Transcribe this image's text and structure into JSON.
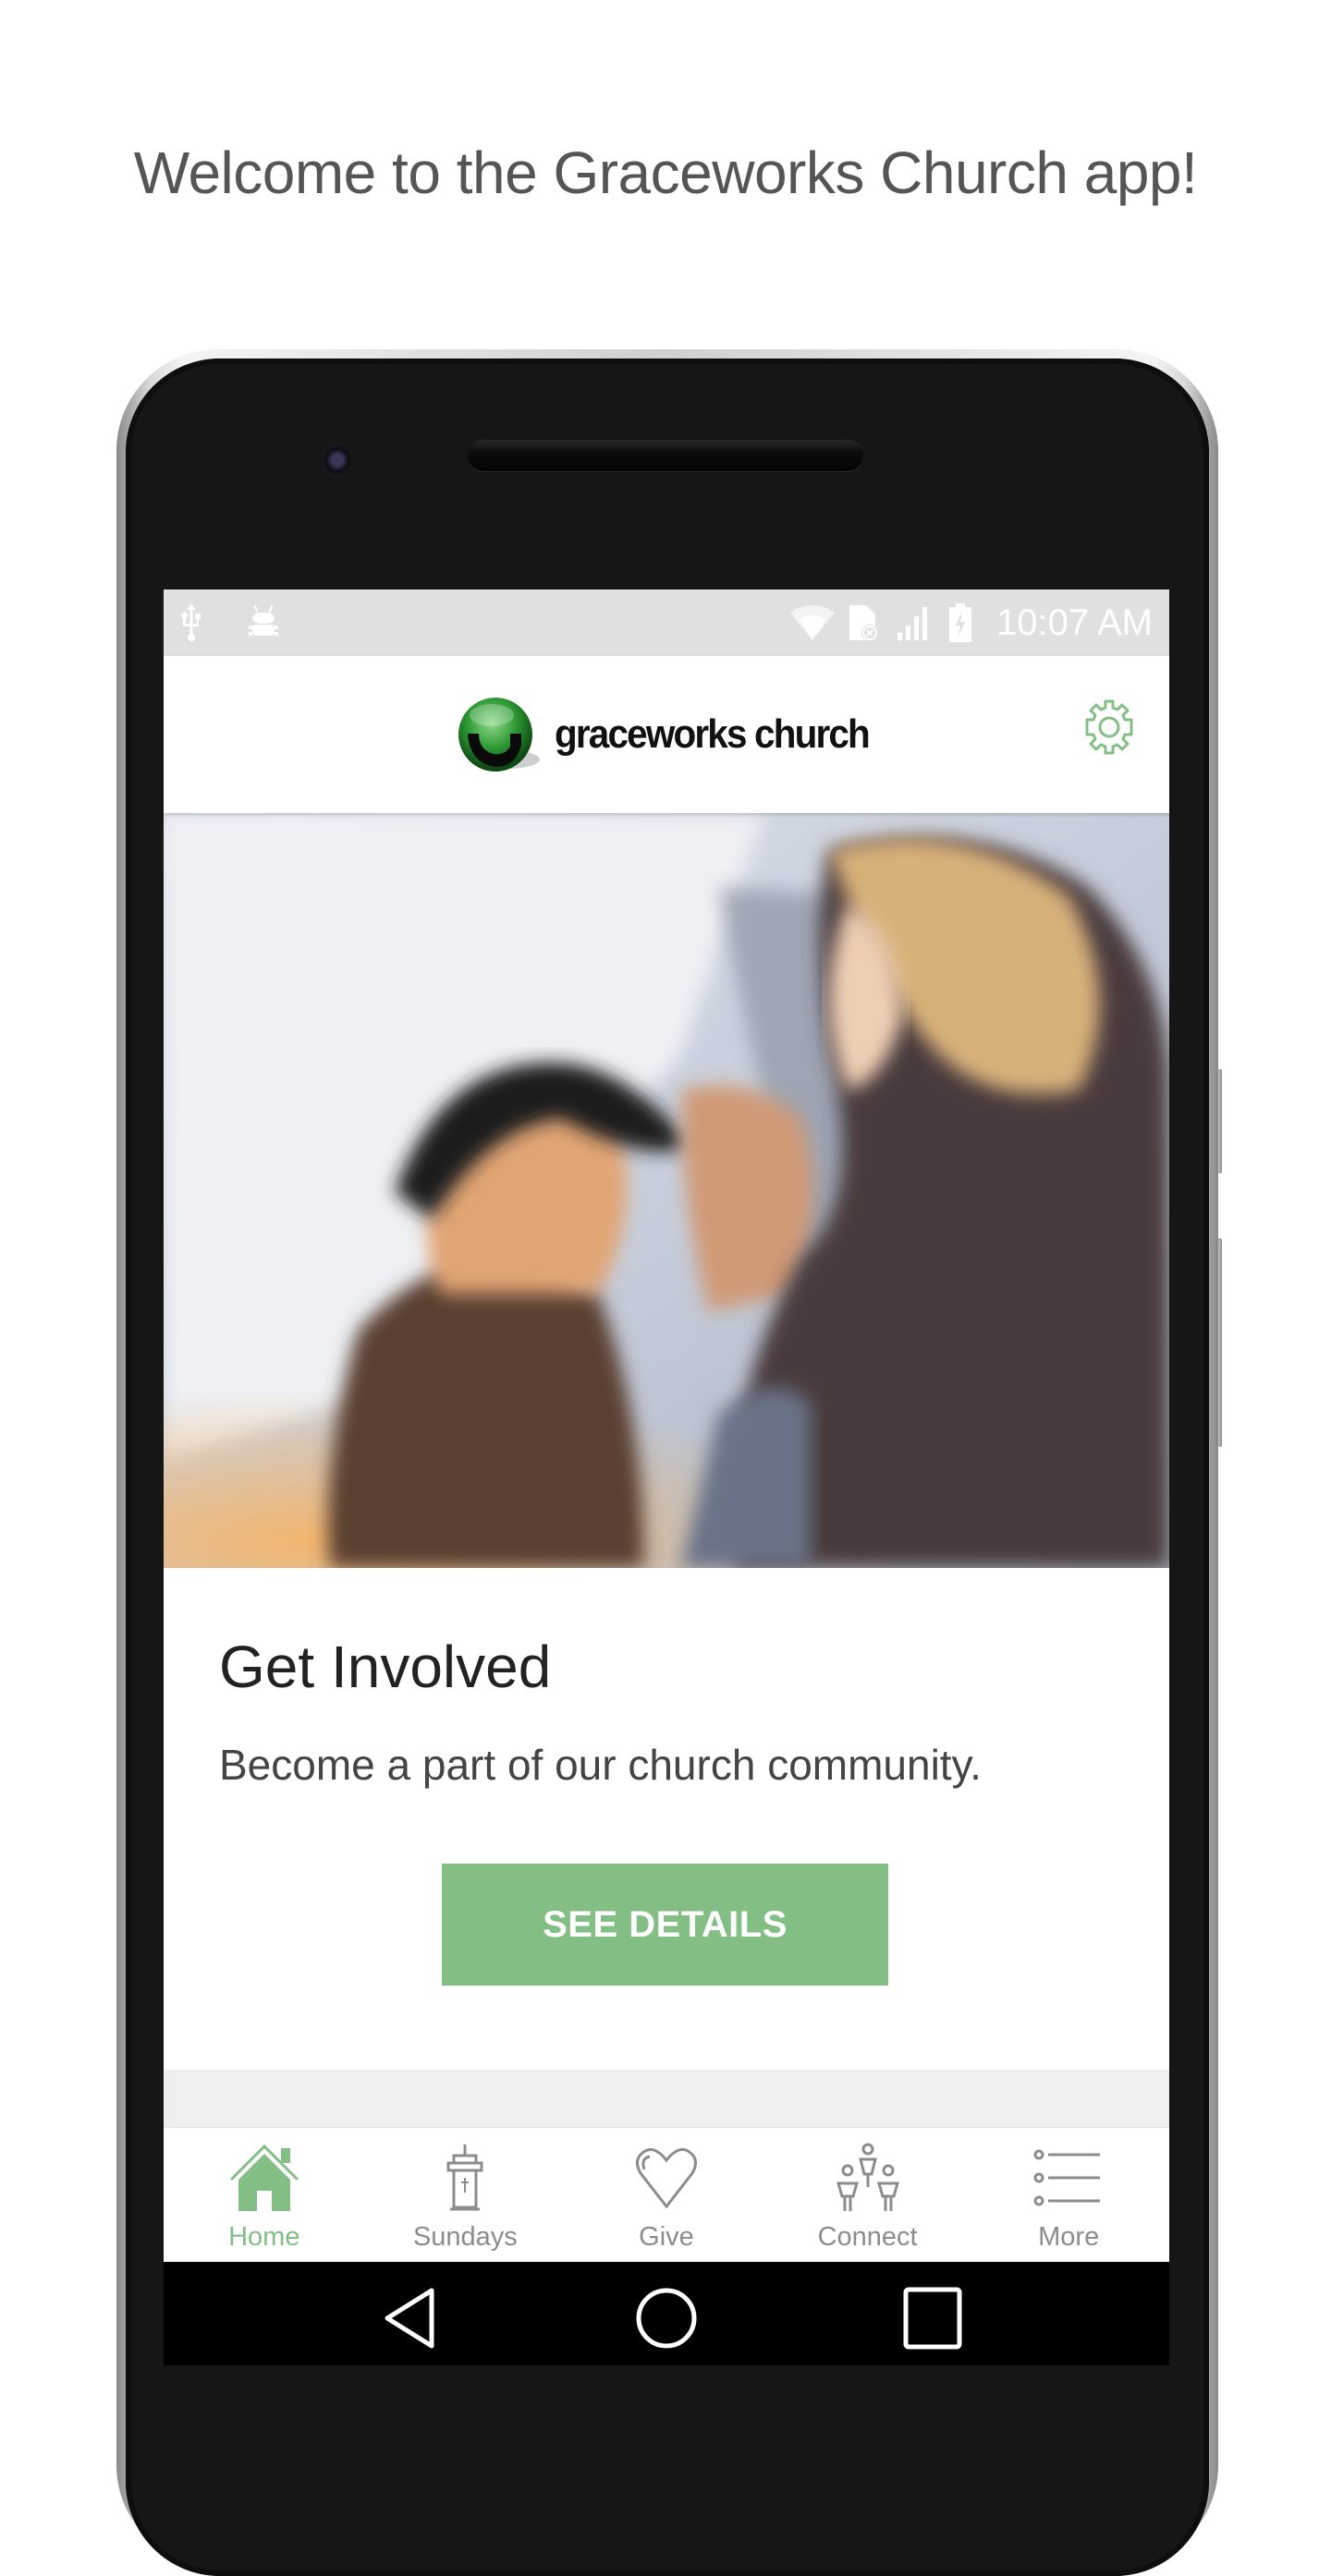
{
  "headline": "Welcome to the Graceworks Church app!",
  "statusbar": {
    "left_icons": [
      "usb-icon",
      "android-debug-icon"
    ],
    "right_icons": [
      "wifi-icon",
      "sim-missing-icon",
      "signal-icon",
      "battery-charging-icon"
    ],
    "time": "10:07 AM"
  },
  "header": {
    "logo_text": "graceworks church",
    "settings_icon": "gear-icon"
  },
  "hero": {
    "description": "Photo of three smiling women outdoors"
  },
  "card": {
    "title": "Get Involved",
    "subtitle": "Become a part of our church community.",
    "button_label": "SEE DETAILS"
  },
  "tabs": [
    {
      "label": "Home",
      "icon": "home-icon",
      "active": true
    },
    {
      "label": "Sundays",
      "icon": "pulpit-icon",
      "active": false
    },
    {
      "label": "Give",
      "icon": "heart-icon",
      "active": false
    },
    {
      "label": "Connect",
      "icon": "people-group-icon",
      "active": false
    },
    {
      "label": "More",
      "icon": "list-icon",
      "active": false
    }
  ],
  "navbar": [
    "back-icon",
    "home-circle-icon",
    "recents-icon"
  ],
  "colors": {
    "accent": "#83bf85",
    "inactive": "#8c8c8c",
    "statusbar": "#e0e0e0"
  }
}
